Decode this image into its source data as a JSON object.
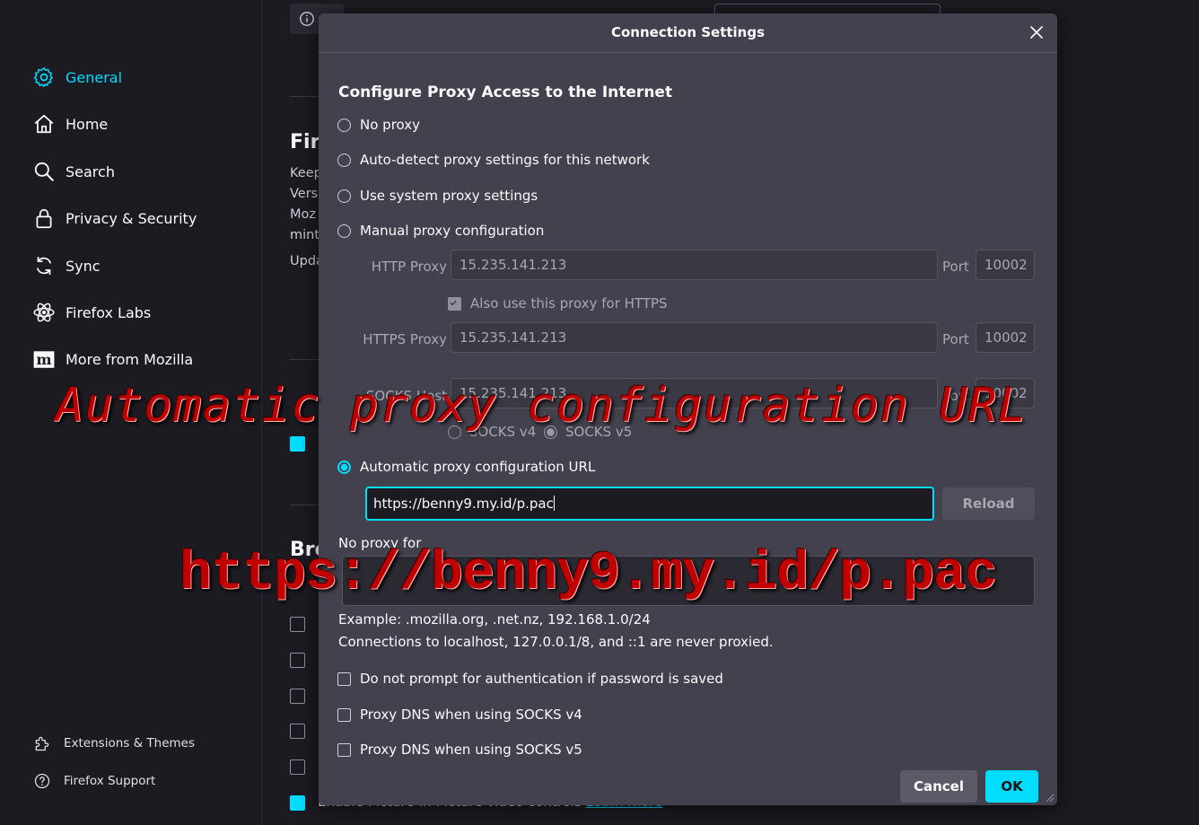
{
  "sidebar": {
    "items": [
      {
        "label": "General",
        "icon": "gear-icon",
        "active": true
      },
      {
        "label": "Home",
        "icon": "home-icon"
      },
      {
        "label": "Search",
        "icon": "search-icon"
      },
      {
        "label": "Privacy & Security",
        "icon": "lock-icon"
      },
      {
        "label": "Sync",
        "icon": "sync-icon"
      },
      {
        "label": "Firefox Labs",
        "icon": "labs-icon"
      },
      {
        "label": "More from Mozilla",
        "icon": "mozilla-icon"
      }
    ],
    "footer": [
      {
        "label": "Extensions & Themes",
        "icon": "puzzle-icon"
      },
      {
        "label": "Firefox Support",
        "icon": "help-icon"
      }
    ]
  },
  "background": {
    "heading_firefox": "Fir",
    "text_lines": [
      "Keep",
      "Vers",
      "Moz",
      "mint",
      "Upda"
    ],
    "heading_browsing": "Bro",
    "last_row_text": "Enable Picture-in-Picture video controls",
    "last_row_link": "Learn more"
  },
  "dialog": {
    "title": "Connection Settings",
    "section_heading": "Configure Proxy Access to the Internet",
    "options": {
      "no_proxy": "No proxy",
      "auto_detect": "Auto-detect proxy settings for this network",
      "system": "Use system proxy settings",
      "manual": "Manual proxy configuration",
      "auto_url": "Automatic proxy configuration URL"
    },
    "selected_option": "auto_url",
    "http_proxy": {
      "label": "HTTP Proxy",
      "value": "15.235.141.213",
      "port_label": "Port",
      "port": "10002"
    },
    "also_https": {
      "label": "Also use this proxy for HTTPS",
      "checked": true
    },
    "https_proxy": {
      "label": "HTTPS Proxy",
      "value": "15.235.141.213",
      "port_label": "Port",
      "port": "10002"
    },
    "socks_host": {
      "label": "SOCKS Host",
      "value": "15.235.141.213",
      "port_label": "Port",
      "port": "10002"
    },
    "socks_v4": "SOCKS v4",
    "socks_v5": "SOCKS v5",
    "pac_url": "https://benny9.my.id/p.pac",
    "reload_label": "Reload",
    "no_proxy_for_label": "No proxy for",
    "no_proxy_for_value": "",
    "example_note": "Example: .mozilla.org, .net.nz, 192.168.1.0/24",
    "localhost_note": "Connections to localhost, 127.0.0.1/8, and ::1 are never proxied.",
    "checkboxes": {
      "no_prompt_auth": "Do not prompt for authentication if password is saved",
      "dns_socks4": "Proxy DNS when using SOCKS v4",
      "dns_socks5": "Proxy DNS when using SOCKS v5"
    },
    "cancel_label": "Cancel",
    "ok_label": "OK"
  },
  "overlays": {
    "caption1": "Automatic proxy configuration URL",
    "caption2": "https://benny9.my.id/p.pac"
  },
  "colors": {
    "accent": "#00ddff",
    "overlay_red": "#c00000",
    "dialog_bg": "#42414d",
    "page_bg": "#1c1b22"
  }
}
